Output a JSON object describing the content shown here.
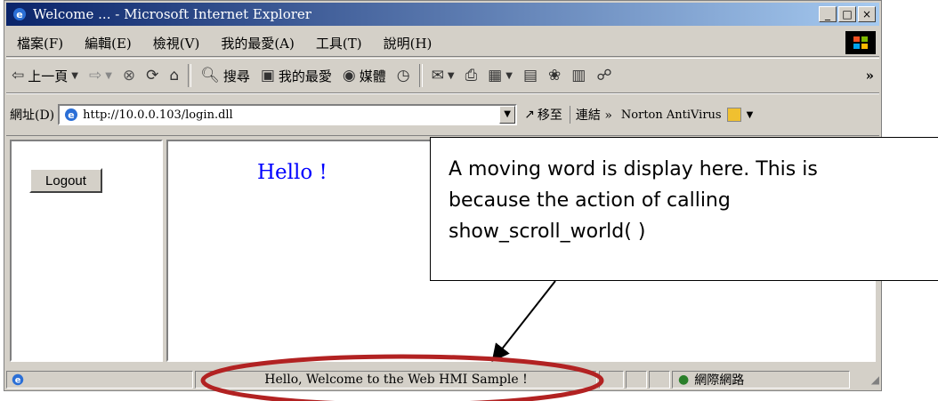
{
  "window": {
    "title": "Welcome ... - Microsoft Internet Explorer",
    "buttons": [
      "_",
      "□",
      "×"
    ]
  },
  "menu": [
    "檔案(F)",
    "編輯(E)",
    "檢視(V)",
    "我的最愛(A)",
    "工具(T)",
    "說明(H)"
  ],
  "toolbar": {
    "back": "上一頁",
    "search": "搜尋",
    "favorites": "我的最愛",
    "media": "媒體",
    "overflow": "»"
  },
  "address": {
    "label": "網址(D)",
    "url": "http://10.0.0.103/login.dll",
    "go": "移至",
    "links": "連結 »",
    "norton": "Norton AntiVirus"
  },
  "page": {
    "logout_label": "Logout",
    "hello_text": "Hello !"
  },
  "status": {
    "message": "Hello, Welcome to the Web HMI Sample !",
    "zone": "網際網路"
  },
  "callout": {
    "lines": [
      "A moving word is display here. This is",
      "because the action of calling",
      "show_scroll_world( )"
    ]
  },
  "colors": {
    "title_start": "#0a246a",
    "title_end": "#a6caf0",
    "hello": "#0000ff",
    "annotation_ellipse": "#b22222"
  }
}
